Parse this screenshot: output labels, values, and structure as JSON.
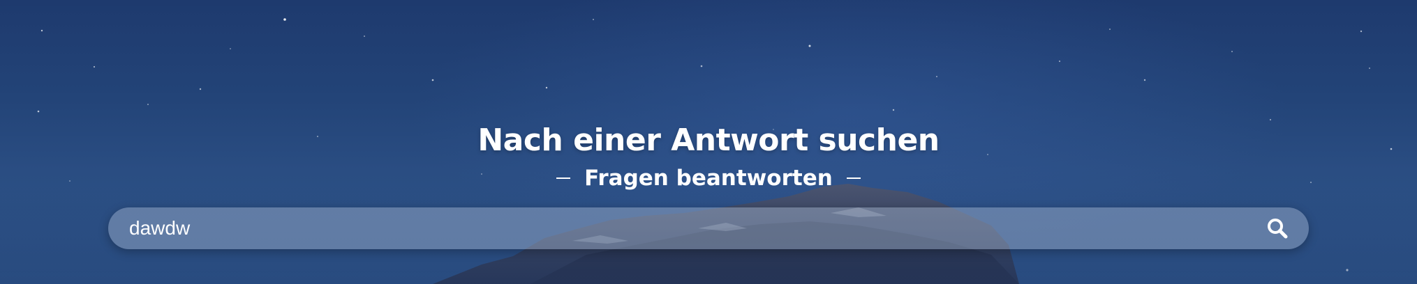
{
  "hero": {
    "title": "Nach einer Antwort suchen",
    "subtitle": "Fragen beantworten"
  },
  "search": {
    "value": "dawdw",
    "placeholder": "",
    "button_icon": "search-icon"
  },
  "colors": {
    "sky_top": "#1e3a6e",
    "sky_bottom": "#2e5388",
    "text": "#ffffff"
  }
}
